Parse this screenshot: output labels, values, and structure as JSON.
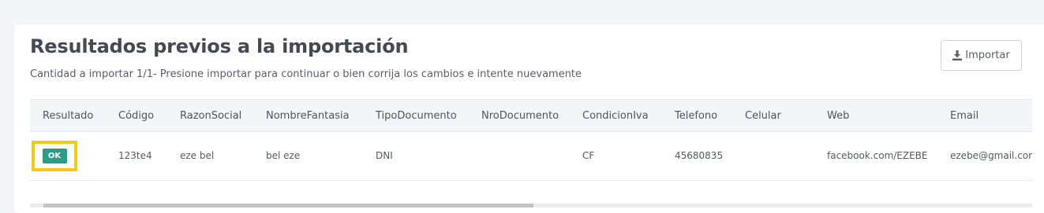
{
  "header": {
    "title": "Resultados previos a la importación",
    "subtitle": "Cantidad a importar 1/1- Presione importar para continuar o bien corrija los cambios e intente nuevamente"
  },
  "import_button": {
    "label": "Importar",
    "icon": "download-icon"
  },
  "table": {
    "columns": [
      "Resultado",
      "Código",
      "RazonSocial",
      "NombreFantasia",
      "TipoDocumento",
      "NroDocumento",
      "CondicionIva",
      "Telefono",
      "Celular",
      "Web",
      "Email"
    ],
    "rows": [
      {
        "resultado": "OK",
        "codigo": "123te4",
        "razon_social": "eze bel",
        "nombre_fantasia": "bel eze",
        "tipo_documento": "DNI",
        "nro_documento": "",
        "condicion_iva": "CF",
        "telefono": "45680835",
        "celular": "",
        "web": "facebook.com/EZEBE",
        "email": "ezebe@gmail.com"
      }
    ]
  },
  "colors": {
    "ok_badge": "#2b9c88",
    "highlight": "#f6c915"
  }
}
